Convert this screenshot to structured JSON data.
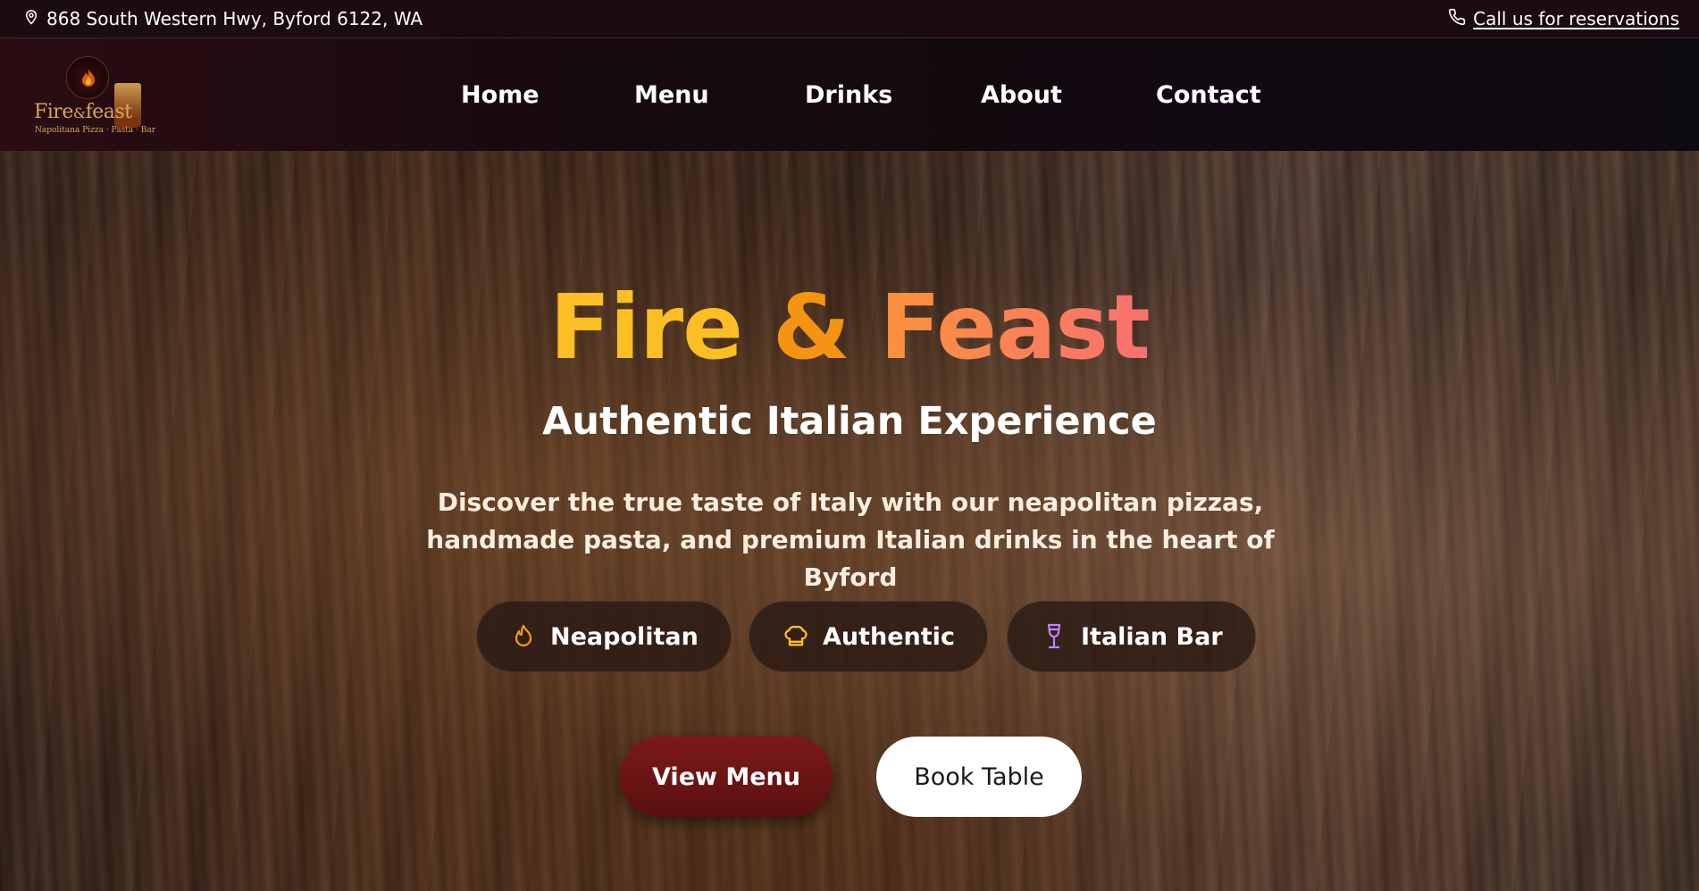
{
  "topbar": {
    "address": "868 South Western Hwy, Byford 6122, WA",
    "phone_link": "Call us for reservations",
    "address_icon": "map-pin-icon",
    "phone_icon": "phone-icon"
  },
  "logo": {
    "name_part1": "Fire",
    "name_amp": "&",
    "name_part2": "feast",
    "tagline": "Napolitana Pizza · Pasta · Bar"
  },
  "nav": {
    "items": [
      {
        "label": "Home"
      },
      {
        "label": "Menu"
      },
      {
        "label": "Drinks"
      },
      {
        "label": "About"
      },
      {
        "label": "Contact"
      }
    ]
  },
  "hero": {
    "title_fire": "Fire",
    "title_amp": "&",
    "title_feast": "Feast",
    "subtitle": "Authentic Italian Experience",
    "description": "Discover the true taste of Italy with our neapolitan pizzas, handmade pasta, and premium Italian drinks in the heart of Byford",
    "badges": [
      {
        "label": "Neapolitan",
        "icon": "flame-icon",
        "color": "#f59e0b"
      },
      {
        "label": "Authentic",
        "icon": "chef-hat-icon",
        "color": "#fbbf24"
      },
      {
        "label": "Italian Bar",
        "icon": "wine-glass-icon",
        "color": "#c084fc"
      }
    ],
    "buttons": {
      "view_menu": "View Menu",
      "book_table": "Book Table"
    }
  },
  "colors": {
    "topbar_bg": "#1b0c12",
    "title_fire": "#fbbf24",
    "title_amp": "#f59312",
    "title_feast_from": "#fb923c",
    "title_feast_to": "#f87171",
    "primary_button": "#7c1a1a"
  }
}
